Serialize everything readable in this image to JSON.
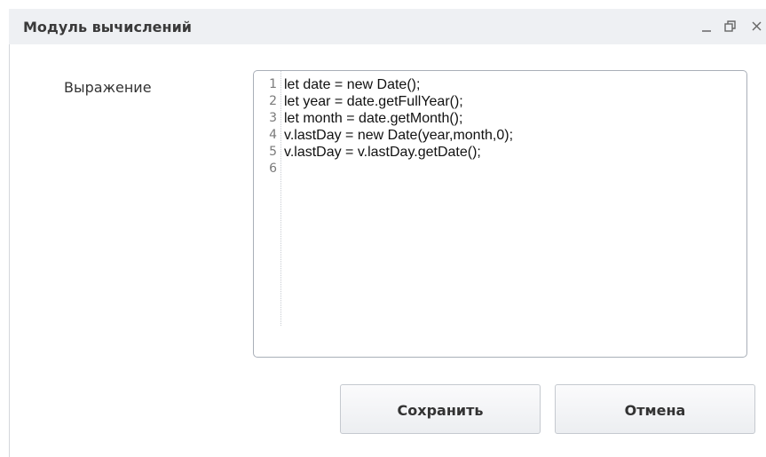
{
  "window": {
    "title": "Модуль вычислений",
    "minimize_icon": "minimize-icon",
    "restore_icon": "restore-icon",
    "close_icon": "close-icon"
  },
  "form": {
    "expression_label": "Выражение"
  },
  "editor": {
    "lines": [
      {
        "number": "1",
        "code": "let date = new Date();"
      },
      {
        "number": "2",
        "code": "let year = date.getFullYear();"
      },
      {
        "number": "3",
        "code": "let month = date.getMonth();"
      },
      {
        "number": "4",
        "code": "v.lastDay = new Date(year,month,0);"
      },
      {
        "number": "5",
        "code": "v.lastDay = v.lastDay.getDate();"
      },
      {
        "number": "6",
        "code": ""
      }
    ]
  },
  "buttons": {
    "save_label": "Сохранить",
    "cancel_label": "Отмена"
  },
  "colors": {
    "titlebar_bg": "#eef0f3",
    "border": "#a9afb8"
  }
}
